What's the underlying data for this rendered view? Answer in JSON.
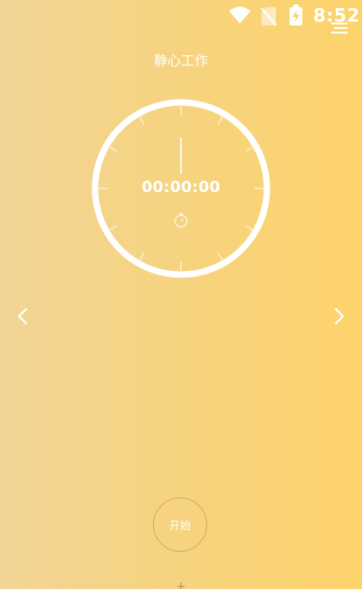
{
  "status_bar": {
    "time": "8:52",
    "icons": [
      "wifi-icon",
      "no-sim-icon",
      "battery-charging-icon"
    ]
  },
  "header": {
    "title": "静心工作",
    "menu_icon": "menu-icon"
  },
  "timer": {
    "display": "00:00:00",
    "icon": "stopwatch-icon"
  },
  "navigation": {
    "prev_icon": "chevron-left-icon",
    "next_icon": "chevron-right-icon"
  },
  "controls": {
    "start_label": "开始"
  },
  "colors": {
    "gradient_left": "#F2D596",
    "gradient_right": "#FDD36B",
    "dial": "#FFFFFF",
    "button_border": "#D9A95F"
  }
}
